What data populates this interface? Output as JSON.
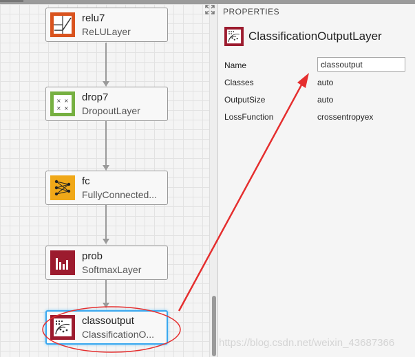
{
  "layers": [
    {
      "name": "relu7",
      "type": "ReLULayer",
      "icon": "relu-icon",
      "color": "#d9531e"
    },
    {
      "name": "drop7",
      "type": "DropoutLayer",
      "icon": "dropout-icon",
      "color": "#76b041"
    },
    {
      "name": "fc",
      "type": "FullyConnected...",
      "icon": "fully-connected-icon",
      "color": "#f0a818"
    },
    {
      "name": "prob",
      "type": "SoftmaxLayer",
      "icon": "softmax-icon",
      "color": "#9c1b2e"
    },
    {
      "name": "classoutput",
      "type": "ClassificationO...",
      "icon": "classification-output-icon",
      "color": "#9c1b2e",
      "selected": true
    }
  ],
  "properties": {
    "title": "PROPERTIES",
    "layer_type": "ClassificationOutputLayer",
    "rows": [
      {
        "label": "Name",
        "value": "classoutput",
        "editable": true
      },
      {
        "label": "Classes",
        "value": "auto"
      },
      {
        "label": "OutputSize",
        "value": "auto"
      },
      {
        "label": "LossFunction",
        "value": "crossentropyex"
      }
    ]
  },
  "annotation_color": "#e52e2e",
  "watermark": "https://blog.csdn.net/weixin_43687366"
}
